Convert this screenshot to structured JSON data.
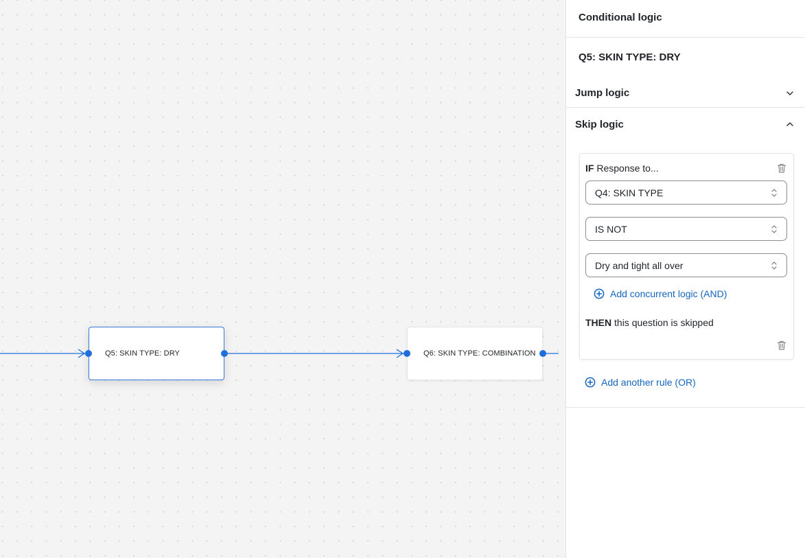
{
  "canvas": {
    "accent_color": "#1e6fdc",
    "nodes": [
      {
        "id": "q5",
        "label": "Q5: SKIN TYPE: DRY",
        "selected": true
      },
      {
        "id": "q6",
        "label": "Q6: SKIN TYPE: COMBINATION",
        "selected": false
      }
    ],
    "edges": [
      {
        "from": "previous",
        "to": "q5"
      },
      {
        "from": "q5",
        "to": "q6"
      },
      {
        "from": "q6",
        "to": "next"
      }
    ]
  },
  "panel": {
    "title": "Conditional logic",
    "question_title": "Q5: SKIN TYPE: DRY",
    "jump_logic": {
      "label": "Jump logic",
      "expanded": false
    },
    "skip_logic": {
      "label": "Skip logic",
      "expanded": true,
      "rule": {
        "if_keyword": "IF",
        "if_text": "Response to...",
        "question_select": "Q4: SKIN TYPE",
        "operator_select": "IS NOT",
        "value_select": "Dry and tight all over",
        "add_and_label": "Add concurrent logic (AND)",
        "then_keyword": "THEN",
        "then_text": "this question is skipped"
      },
      "add_or_label": "Add another rule (OR)"
    },
    "link_color": "#1565c0"
  }
}
